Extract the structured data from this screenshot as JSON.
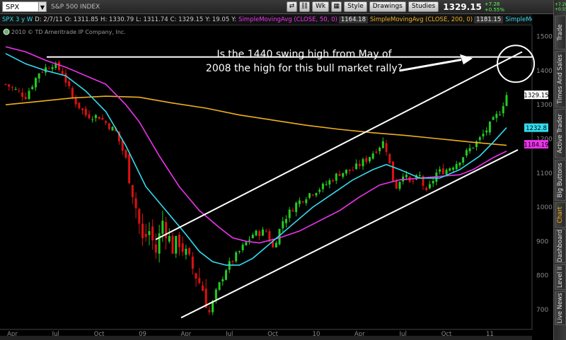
{
  "toolbar": {
    "symbol": "SPX",
    "company": "S&P 500 INDEX",
    "buttons": [
      "Wk",
      "Style",
      "Drawings",
      "Studies"
    ],
    "last_price": "1329.15",
    "change": "+7.28",
    "change_pct": "+0.55%"
  },
  "infobar": {
    "symbol_period": "SPX 3 y W",
    "date": "D: 2/7/11",
    "open": "O: 1311.85",
    "high": "H: 1330.79",
    "low": "L: 1311.74",
    "close": "C: 1329.15",
    "y": "Y: 19.05",
    "y_label": "Y:",
    "study1": "SimpleMovingAvg (CLOSE, 50, 0)",
    "study1_val": "1164.18",
    "study2": "SimpleMovingAvg (CLOSE, 200, 0)",
    "study2_val": "1181.15",
    "study3": "SimpleMoving..."
  },
  "copyright": "2010 © TD Ameritrade IP Company, Inc.",
  "annotation": "Is the 1440 swing high from May of 2008 the high for this bull market rally?",
  "right_tabs": [
    "Trade",
    "Times And Sales",
    "Active Trader",
    "Big Buttons",
    "Chart",
    "Dashboard",
    "Level II",
    "Live News"
  ],
  "rail_top": "+7.28 +0.55%",
  "colors": {
    "up": "#22cc22",
    "down": "#dd1111",
    "sma_fast": "#33ddee",
    "sma50": "#ee33ee",
    "sma200": "#f0b020",
    "annotation_lines": "#ffffff",
    "axis_text": "#8a8a8a"
  },
  "chart_data": {
    "type": "candlestick",
    "title": "S&P 500 INDEX",
    "period": "weekly, 3 years",
    "x_tick_labels": [
      "Apr",
      "Jul",
      "Oct",
      "09",
      "Apr",
      "Jul",
      "Oct",
      "10",
      "Apr",
      "Jul",
      "Oct",
      "11"
    ],
    "y_ticks": [
      700,
      800,
      900,
      1000,
      1100,
      1200,
      1300,
      1400,
      1500
    ],
    "ylim": [
      650,
      1520
    ],
    "n_weeks": 150,
    "price_labels": [
      {
        "text": "1232.8",
        "value": 1232.8,
        "color": "#33ddee"
      },
      {
        "text": "1184.19",
        "value": 1184.19,
        "color": "#ee33ee"
      },
      {
        "text": "1329.15",
        "value": 1329.15,
        "color": "#ffffff"
      }
    ],
    "close_path": [
      [
        0,
        1360
      ],
      [
        6,
        1325
      ],
      [
        10,
        1395
      ],
      [
        14,
        1420
      ],
      [
        17,
        1395
      ],
      [
        20,
        1320
      ],
      [
        24,
        1270
      ],
      [
        28,
        1265
      ],
      [
        33,
        1220
      ],
      [
        36,
        1140
      ],
      [
        39,
        1000
      ],
      [
        41,
        900
      ],
      [
        43,
        930
      ],
      [
        45,
        870
      ],
      [
        47,
        960
      ],
      [
        50,
        880
      ],
      [
        52,
        900
      ],
      [
        55,
        840
      ],
      [
        57,
        800
      ],
      [
        59,
        760
      ],
      [
        61,
        690
      ],
      [
        63,
        750
      ],
      [
        66,
        820
      ],
      [
        70,
        870
      ],
      [
        74,
        920
      ],
      [
        78,
        930
      ],
      [
        80,
        880
      ],
      [
        83,
        960
      ],
      [
        87,
        1010
      ],
      [
        91,
        1040
      ],
      [
        95,
        1060
      ],
      [
        100,
        1100
      ],
      [
        104,
        1110
      ],
      [
        108,
        1140
      ],
      [
        111,
        1170
      ],
      [
        113,
        1190
      ],
      [
        114,
        1170
      ],
      [
        116,
        1080
      ],
      [
        117,
        1060
      ],
      [
        119,
        1100
      ],
      [
        121,
        1070
      ],
      [
        124,
        1090
      ],
      [
        126,
        1040
      ],
      [
        129,
        1100
      ],
      [
        132,
        1110
      ],
      [
        135,
        1130
      ],
      [
        139,
        1170
      ],
      [
        142,
        1200
      ],
      [
        145,
        1240
      ],
      [
        148,
        1280
      ],
      [
        150,
        1329
      ]
    ],
    "sma_fast_path": [
      [
        0,
        1450
      ],
      [
        6,
        1420
      ],
      [
        12,
        1400
      ],
      [
        18,
        1385
      ],
      [
        24,
        1340
      ],
      [
        30,
        1280
      ],
      [
        36,
        1180
      ],
      [
        42,
        1060
      ],
      [
        48,
        990
      ],
      [
        54,
        920
      ],
      [
        58,
        870
      ],
      [
        62,
        840
      ],
      [
        66,
        830
      ],
      [
        70,
        830
      ],
      [
        74,
        850
      ],
      [
        80,
        900
      ],
      [
        86,
        950
      ],
      [
        92,
        1000
      ],
      [
        98,
        1040
      ],
      [
        104,
        1080
      ],
      [
        110,
        1110
      ],
      [
        114,
        1125
      ],
      [
        118,
        1110
      ],
      [
        124,
        1085
      ],
      [
        130,
        1085
      ],
      [
        136,
        1110
      ],
      [
        142,
        1150
      ],
      [
        146,
        1190
      ],
      [
        150,
        1232.8
      ]
    ],
    "sma50_path": [
      [
        0,
        1470
      ],
      [
        6,
        1455
      ],
      [
        12,
        1430
      ],
      [
        18,
        1410
      ],
      [
        24,
        1385
      ],
      [
        30,
        1360
      ],
      [
        36,
        1300
      ],
      [
        40,
        1250
      ],
      [
        46,
        1150
      ],
      [
        52,
        1060
      ],
      [
        58,
        990
      ],
      [
        64,
        940
      ],
      [
        68,
        910
      ],
      [
        72,
        900
      ],
      [
        76,
        895
      ],
      [
        82,
        910
      ],
      [
        88,
        930
      ],
      [
        94,
        960
      ],
      [
        100,
        990
      ],
      [
        106,
        1030
      ],
      [
        112,
        1065
      ],
      [
        118,
        1080
      ],
      [
        124,
        1085
      ],
      [
        130,
        1090
      ],
      [
        136,
        1095
      ],
      [
        140,
        1110
      ],
      [
        146,
        1145
      ],
      [
        150,
        1164.18
      ]
    ],
    "sma200_path": [
      [
        0,
        1300
      ],
      [
        10,
        1310
      ],
      [
        20,
        1320
      ],
      [
        30,
        1325
      ],
      [
        40,
        1322
      ],
      [
        50,
        1305
      ],
      [
        60,
        1290
      ],
      [
        70,
        1270
      ],
      [
        80,
        1255
      ],
      [
        90,
        1240
      ],
      [
        100,
        1228
      ],
      [
        110,
        1218
      ],
      [
        120,
        1210
      ],
      [
        130,
        1200
      ],
      [
        140,
        1190
      ],
      [
        150,
        1181.15
      ]
    ]
  }
}
